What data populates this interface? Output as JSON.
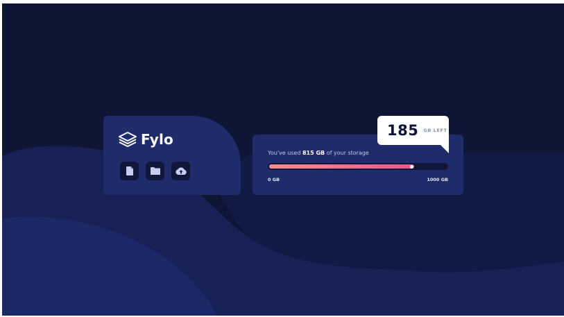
{
  "brand": {
    "name": "Fylo",
    "logo_icon": "layers-icon"
  },
  "actions": [
    {
      "icon": "document-icon"
    },
    {
      "icon": "folder-icon"
    },
    {
      "icon": "cloud-upload-icon"
    }
  ],
  "storage": {
    "used_prefix": "You've used ",
    "used_amount": "815 GB",
    "used_suffix": " of your storage",
    "progress_fraction": 0.815,
    "scale_min": "0 GB",
    "scale_max": "1000 GB"
  },
  "remaining": {
    "number": "185",
    "unit": "GB LEFT"
  },
  "colors": {
    "background": "#0f1535",
    "card": "#1f2b6b",
    "gradient_start": "#f78e8e",
    "gradient_end": "#e8588f"
  }
}
